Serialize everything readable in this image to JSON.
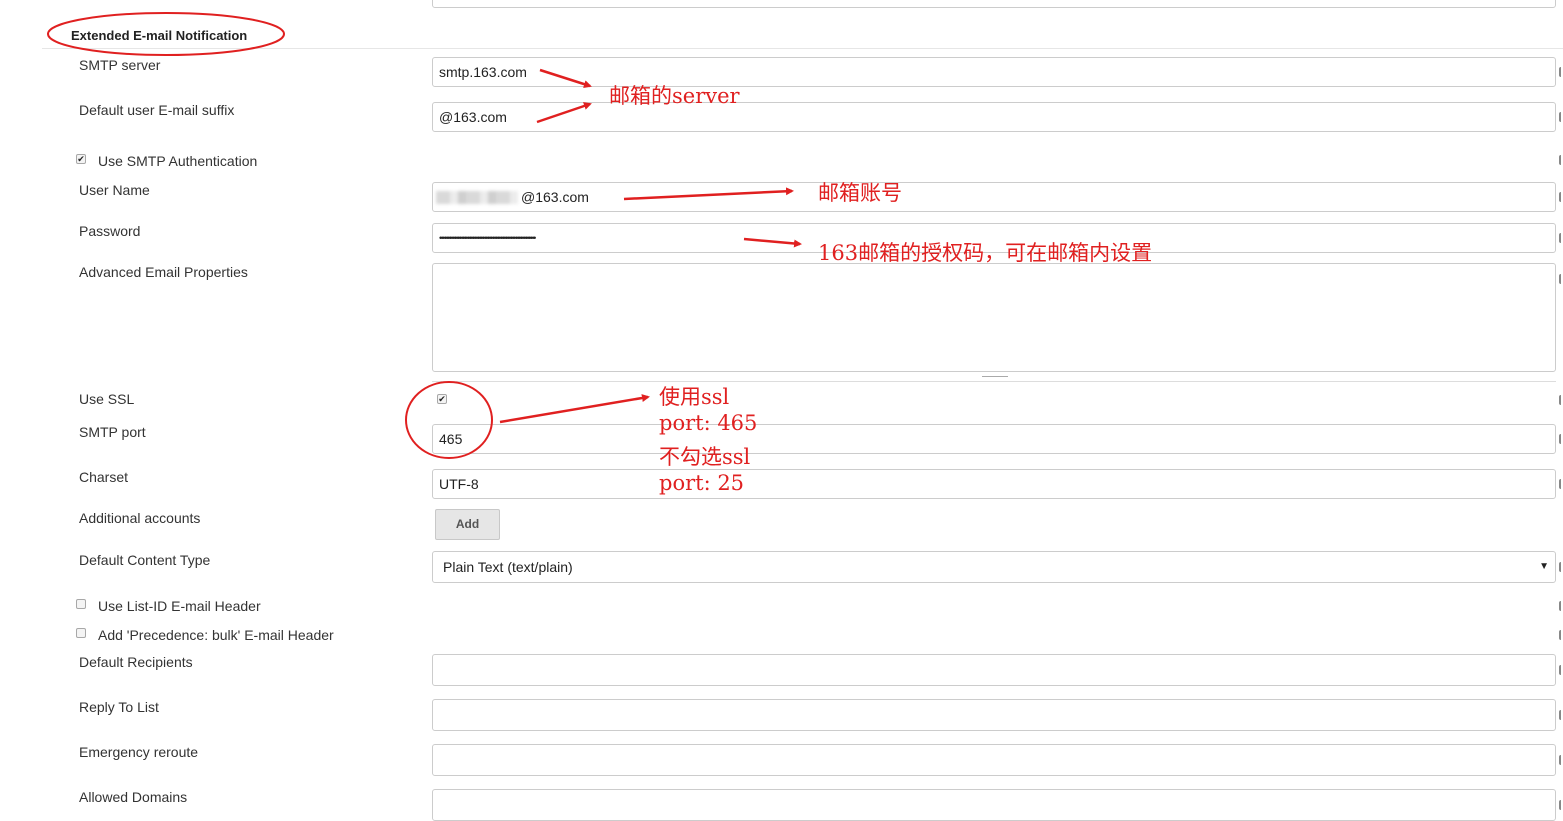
{
  "section": {
    "title": "Extended E-mail Notification"
  },
  "fields": {
    "smtp_server": {
      "label": "SMTP server",
      "value": "smtp.163.com"
    },
    "email_suffix": {
      "label": "Default user E-mail suffix",
      "value": "@163.com"
    },
    "use_smtp_auth": {
      "label": "Use SMTP Authentication",
      "checked": true
    },
    "user_name": {
      "label": "User Name",
      "value": "@163.com"
    },
    "password": {
      "label": "Password",
      "value": "••••••••••••••••••••••••••••••••••••••••••••••••••••••••••"
    },
    "advanced_props": {
      "label": "Advanced Email Properties",
      "value": ""
    },
    "use_ssl": {
      "label": "Use SSL",
      "checked": true
    },
    "smtp_port": {
      "label": "SMTP port",
      "value": "465"
    },
    "charset": {
      "label": "Charset",
      "value": "UTF-8"
    },
    "additional_accounts": {
      "label": "Additional accounts",
      "button": "Add"
    },
    "content_type": {
      "label": "Default Content Type",
      "value": "Plain Text (text/plain)"
    },
    "list_id_header": {
      "label": "Use List-ID E-mail Header",
      "checked": false
    },
    "precedence_header": {
      "label": "Add 'Precedence: bulk' E-mail Header",
      "checked": false
    },
    "default_recipients": {
      "label": "Default Recipients",
      "value": ""
    },
    "reply_to": {
      "label": "Reply To List",
      "value": ""
    },
    "emergency_reroute": {
      "label": "Emergency reroute",
      "value": ""
    },
    "allowed_domains": {
      "label": "Allowed Domains",
      "value": ""
    }
  },
  "annotations": {
    "server_note": "邮箱的server",
    "account_note": "邮箱账号",
    "authcode_note": "163邮箱的授权码，可在邮箱内设置",
    "ssl_line1": "使用ssl",
    "ssl_line2": "port: 465",
    "ssl_line3": "不勾选ssl",
    "ssl_line4": "port: 25"
  },
  "colors": {
    "annotation": "#e02020",
    "border": "#cccccc"
  }
}
